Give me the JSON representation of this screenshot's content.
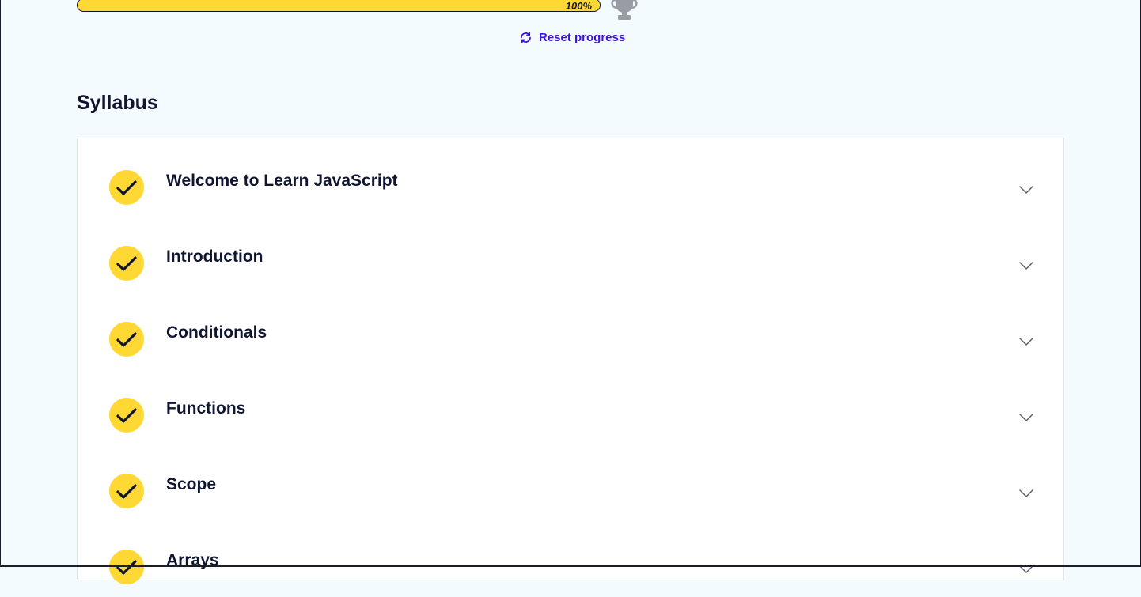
{
  "progress": {
    "percent_label": "100%",
    "fraction": 1.0
  },
  "reset": {
    "label": "Reset progress"
  },
  "syllabus": {
    "title": "Syllabus",
    "modules": [
      {
        "title": "Welcome to Learn JavaScript",
        "completed": true
      },
      {
        "title": "Introduction",
        "completed": true
      },
      {
        "title": "Conditionals",
        "completed": true
      },
      {
        "title": "Functions",
        "completed": true
      },
      {
        "title": "Scope",
        "completed": true
      },
      {
        "title": "Arrays",
        "completed": true
      }
    ]
  },
  "icons": {
    "trophy": "trophy-icon",
    "reset": "refresh-icon",
    "check": "checkmark-icon",
    "chevron": "chevron-down-icon"
  },
  "colors": {
    "accent_yellow": "#ffd833",
    "link_purple": "#3a10e5",
    "navy": "#10162f",
    "background": "#f3fbff",
    "trophy_gray": "#9a9ca3"
  }
}
